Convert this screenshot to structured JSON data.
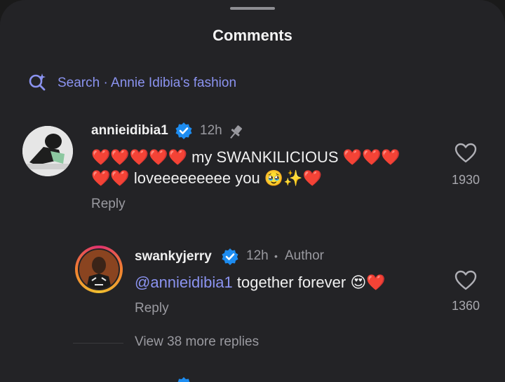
{
  "header": {
    "title": "Comments"
  },
  "search": {
    "label": "Search · Annie Idibia's fashion"
  },
  "comments": [
    {
      "username": "annieidibia1",
      "time": "12h",
      "text_line1": "❤️❤️❤️❤️❤️ my SWANKILICIOUS ❤️❤️❤️",
      "text_line2": "❤️❤️ loveeeeeeeee you 🥹✨❤️",
      "reply_label": "Reply",
      "likes": "1930"
    }
  ],
  "reply": {
    "username": "swankyjerry",
    "time": "12h",
    "author_tag": "Author",
    "mention": "@annieidibia1",
    "text": " together forever 😍❤️",
    "reply_label": "Reply",
    "likes": "1360"
  },
  "view_more": "View 38 more replies",
  "colors": {
    "accent": "#8b93f0",
    "verified": "#1d8cf0",
    "background": "#232326"
  }
}
